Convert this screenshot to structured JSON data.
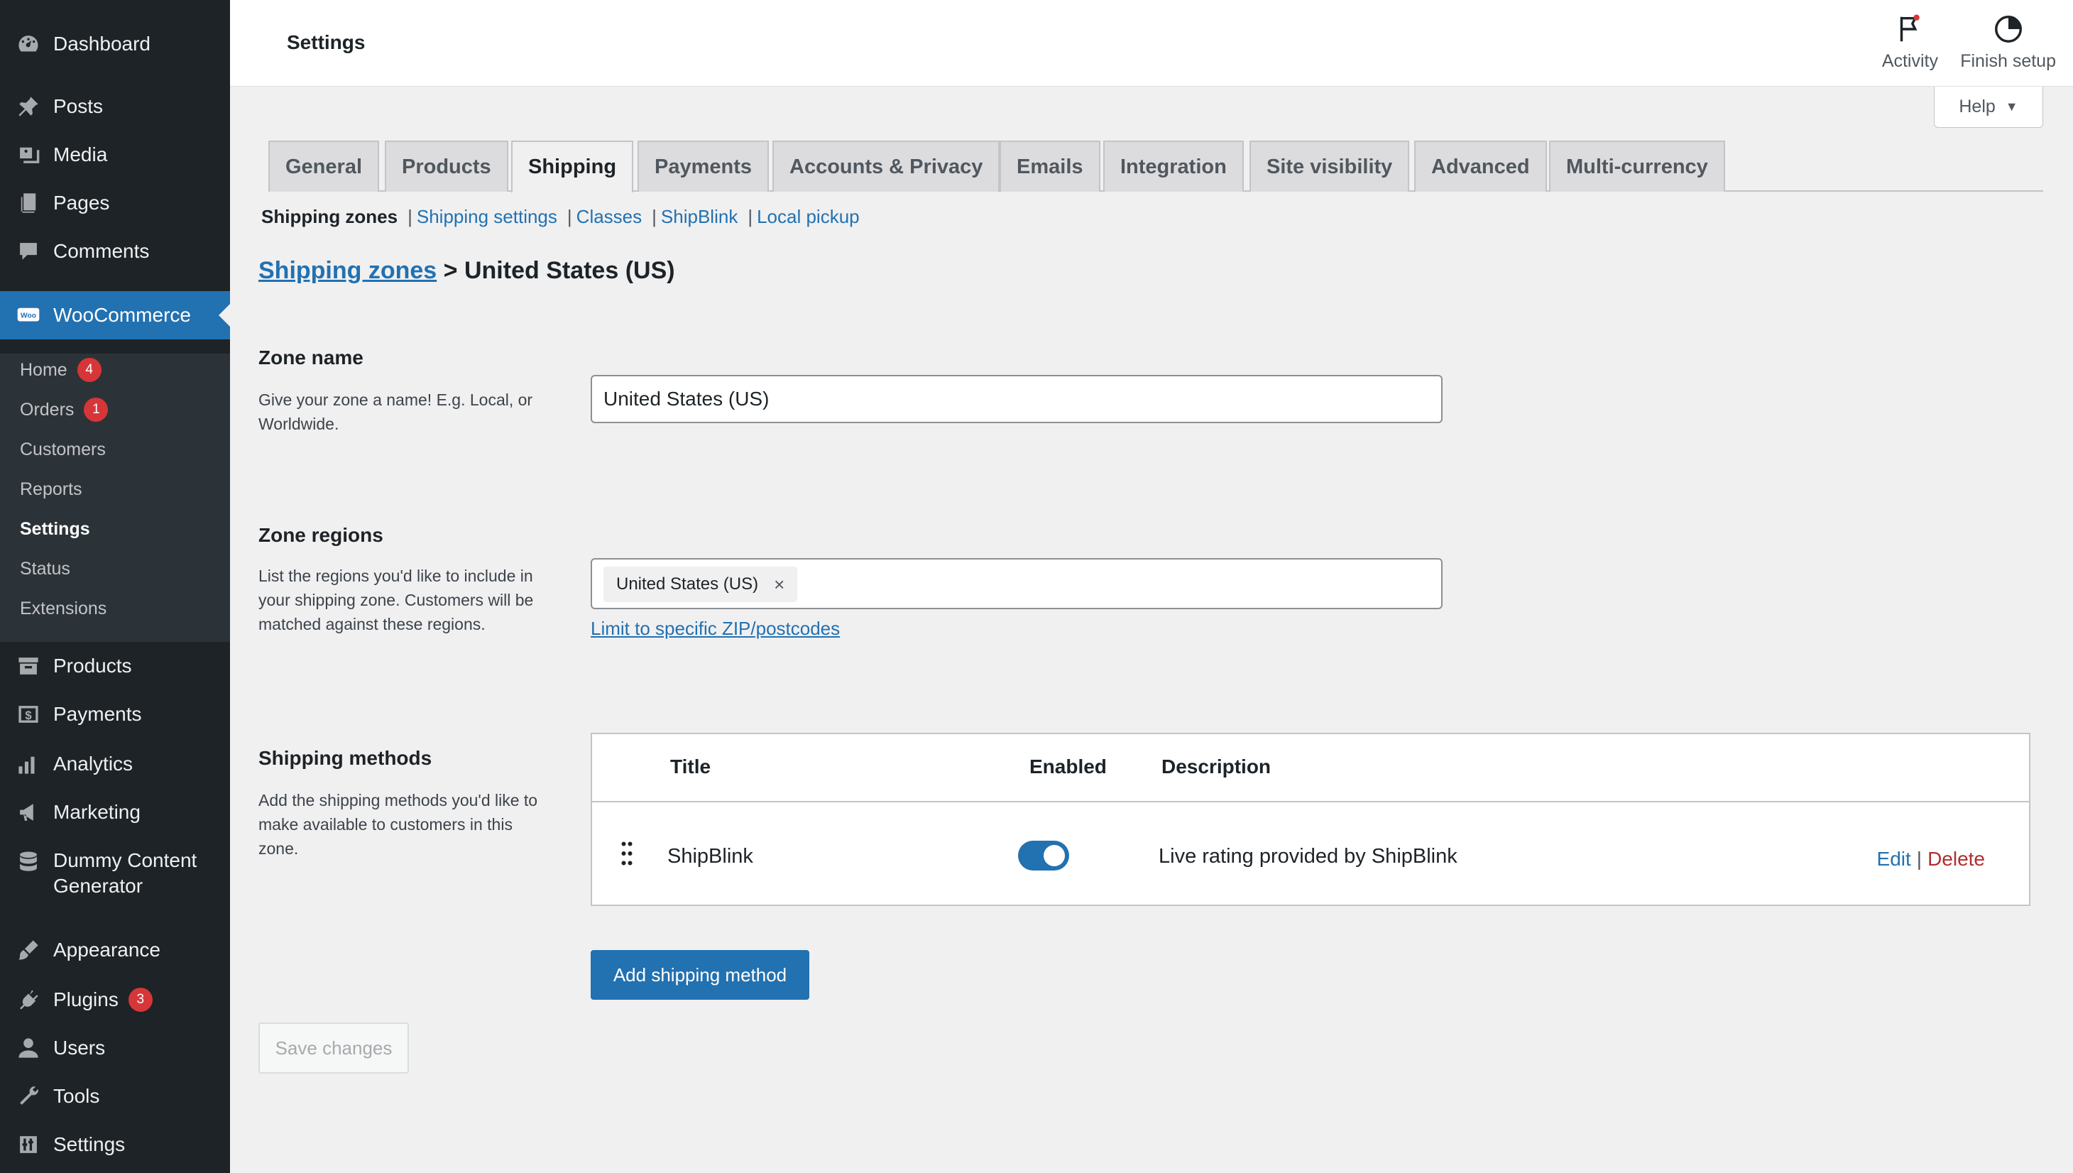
{
  "header": {
    "title": "Settings",
    "activity_label": "Activity",
    "finish_setup_label": "Finish setup",
    "help_label": "Help"
  },
  "sidebar": {
    "items": [
      {
        "label": "Dashboard",
        "icon": "dashboard-icon"
      },
      {
        "label": "Posts",
        "icon": "pin-icon"
      },
      {
        "label": "Media",
        "icon": "media-icon"
      },
      {
        "label": "Pages",
        "icon": "pages-icon"
      },
      {
        "label": "Comments",
        "icon": "comment-icon"
      },
      {
        "label": "WooCommerce",
        "icon": "woo-icon"
      },
      {
        "label": "Products",
        "icon": "archive-icon"
      },
      {
        "label": "Payments",
        "icon": "dollar-icon"
      },
      {
        "label": "Analytics",
        "icon": "bar-chart-icon"
      },
      {
        "label": "Marketing",
        "icon": "megaphone-icon"
      },
      {
        "label": "Dummy Content Generator",
        "icon": "database-icon"
      },
      {
        "label": "Appearance",
        "icon": "brush-icon"
      },
      {
        "label": "Plugins",
        "icon": "plug-icon",
        "badge": "3"
      },
      {
        "label": "Users",
        "icon": "user-icon"
      },
      {
        "label": "Tools",
        "icon": "wrench-icon"
      },
      {
        "label": "Settings",
        "icon": "sliders-icon"
      }
    ],
    "woocommerce_submenu": [
      {
        "label": "Home",
        "badge": "4"
      },
      {
        "label": "Orders",
        "badge": "1"
      },
      {
        "label": "Customers"
      },
      {
        "label": "Reports"
      },
      {
        "label": "Settings",
        "current": true
      },
      {
        "label": "Status"
      },
      {
        "label": "Extensions"
      }
    ]
  },
  "tabs": [
    "General",
    "Products",
    "Shipping",
    "Payments",
    "Accounts & Privacy",
    "Emails",
    "Integration",
    "Site visibility",
    "Advanced",
    "Multi-currency"
  ],
  "active_tab": "Shipping",
  "subsections": [
    "Shipping zones",
    "Shipping settings",
    "Classes",
    "ShipBlink",
    "Local pickup"
  ],
  "breadcrumb": {
    "link": "Shipping zones",
    "separator": ">",
    "current": "United States (US)"
  },
  "zone_name": {
    "title": "Zone name",
    "description": "Give your zone a name! E.g. Local, or Worldwide.",
    "value": "United States (US)"
  },
  "zone_regions": {
    "title": "Zone regions",
    "description": "List the regions you'd like to include in your shipping zone. Customers will be matched against these regions.",
    "selected_region": "United States (US)",
    "remove_glyph": "×",
    "zip_link": "Limit to specific ZIP/postcodes"
  },
  "shipping_methods": {
    "title": "Shipping methods",
    "description": "Add the shipping methods you'd like to make available to customers in this zone.",
    "columns": [
      "Title",
      "Enabled",
      "Description"
    ],
    "rows": [
      {
        "title": "ShipBlink",
        "enabled": true,
        "description": "Live rating provided by ShipBlink",
        "edit": "Edit",
        "delete": "Delete"
      }
    ],
    "add_button": "Add shipping method"
  },
  "save_button": "Save changes",
  "colors": {
    "accent": "#2271b1",
    "sidebar_bg": "#1d2327",
    "badge": "#d63638",
    "delete": "#b32d2e"
  }
}
